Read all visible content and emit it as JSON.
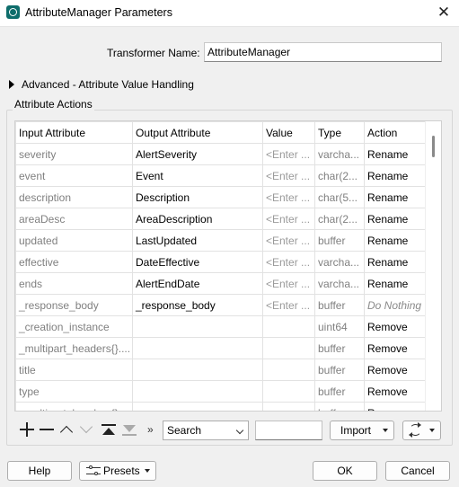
{
  "window": {
    "title": "AttributeManager Parameters"
  },
  "transformer_name": {
    "label": "Transformer Name:",
    "value": "AttributeManager"
  },
  "advanced": {
    "label": "Advanced - Attribute Value Handling"
  },
  "attribute_actions": {
    "label": "Attribute Actions",
    "columns": [
      "Input Attribute",
      "Output Attribute",
      "Value",
      "Type",
      "Action"
    ],
    "rows": [
      {
        "input": "severity",
        "output": "AlertSeverity",
        "value": "<Enter ...",
        "type": "varcha...",
        "action": "Rename"
      },
      {
        "input": "event",
        "output": "Event",
        "value": "<Enter ...",
        "type": "char(2...",
        "action": "Rename"
      },
      {
        "input": "description",
        "output": "Description",
        "value": "<Enter ...",
        "type": "char(5...",
        "action": "Rename"
      },
      {
        "input": "areaDesc",
        "output": "AreaDescription",
        "value": "<Enter ...",
        "type": "char(2...",
        "action": "Rename"
      },
      {
        "input": "updated",
        "output": "LastUpdated",
        "value": "<Enter ...",
        "type": "buffer",
        "action": "Rename"
      },
      {
        "input": "effective",
        "output": "DateEffective",
        "value": "<Enter ...",
        "type": "varcha...",
        "action": "Rename"
      },
      {
        "input": "ends",
        "output": "AlertEndDate",
        "value": "<Enter ...",
        "type": "varcha...",
        "action": "Rename"
      },
      {
        "input": "_response_body",
        "output": "_response_body",
        "value": "<Enter ...",
        "type": "buffer",
        "action": "Do Nothing"
      },
      {
        "input": "_creation_instance",
        "output": "",
        "value": "",
        "type": "uint64",
        "action": "Remove"
      },
      {
        "input": "_multipart_headers{}....",
        "output": "",
        "value": "",
        "type": "buffer",
        "action": "Remove"
      },
      {
        "input": "title",
        "output": "",
        "value": "",
        "type": "buffer",
        "action": "Remove"
      },
      {
        "input": "type",
        "output": "",
        "value": "",
        "type": "buffer",
        "action": "Remove"
      },
      {
        "input": "_multipart_headers{}....",
        "output": "",
        "value": "",
        "type": "buffer",
        "action": "Remove"
      }
    ]
  },
  "toolbar": {
    "separator": "»",
    "search_value": "Search",
    "filter_value": "",
    "import_label": "Import"
  },
  "footer": {
    "help_label": "Help",
    "presets_label": "Presets",
    "ok_label": "OK",
    "cancel_label": "Cancel"
  }
}
